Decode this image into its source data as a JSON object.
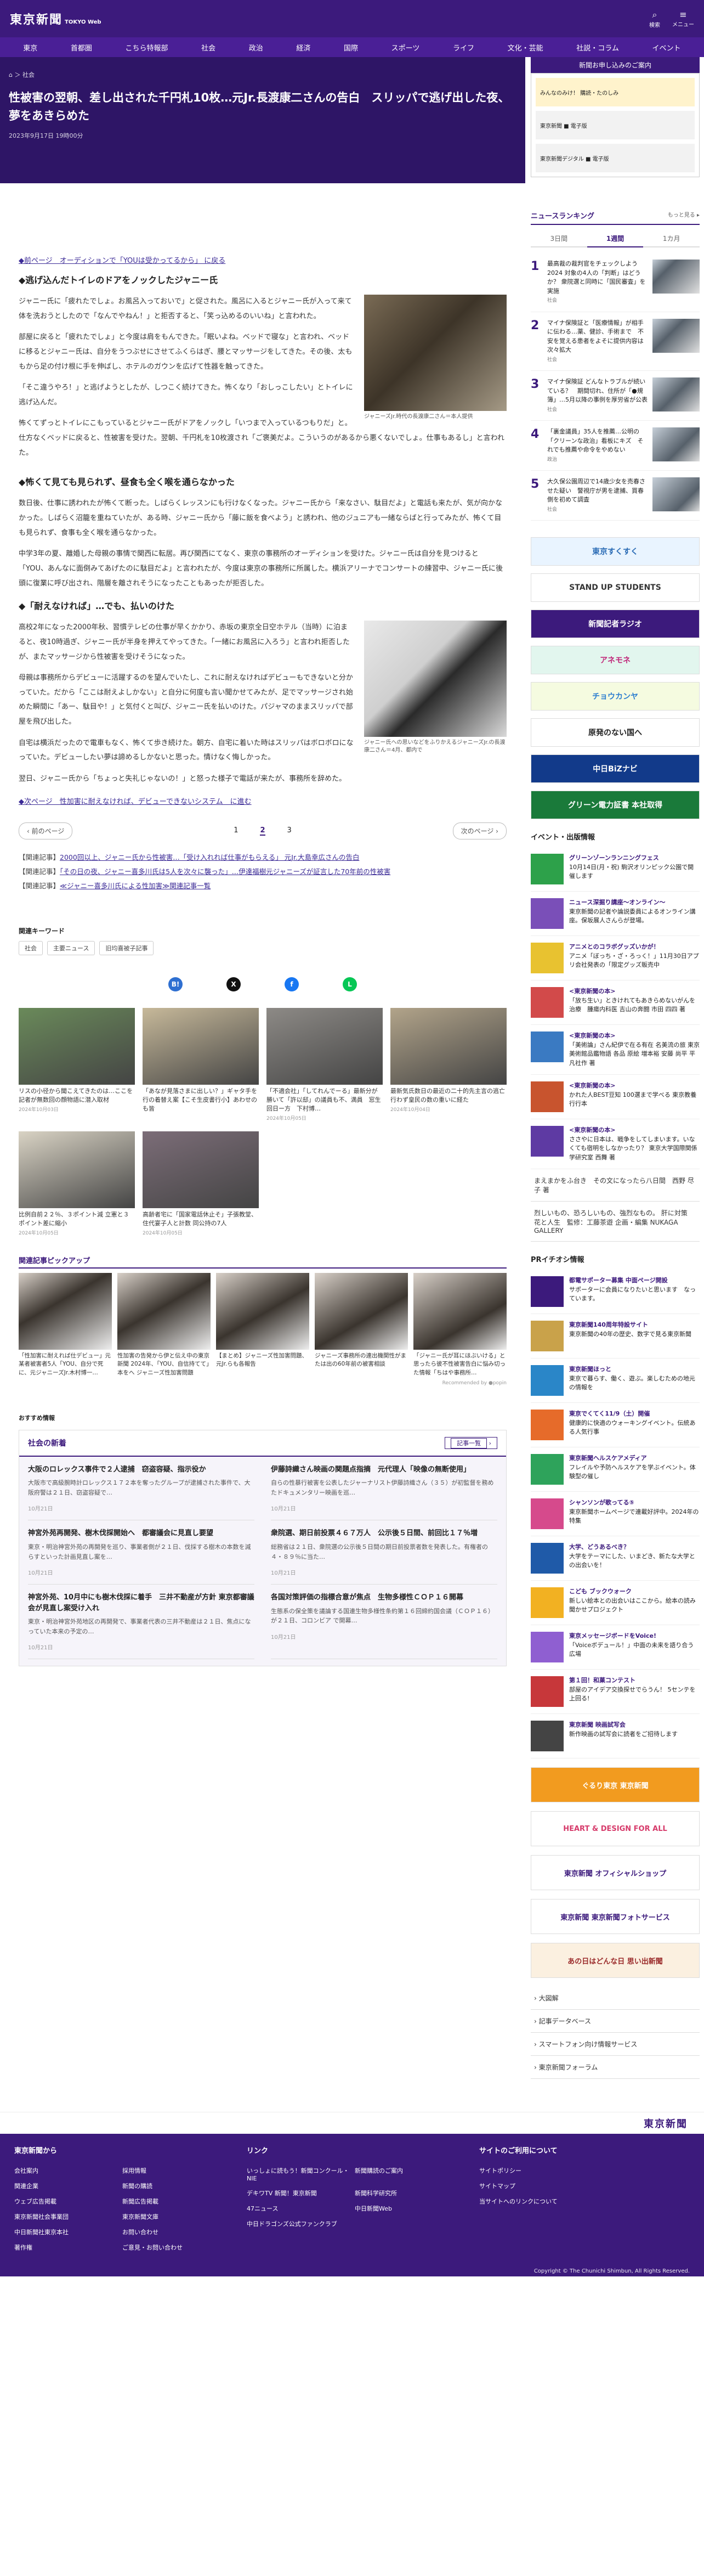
{
  "header": {
    "logo": "東京新聞",
    "logo_sub": "TOKYO Web",
    "icons": [
      {
        "name": "search-icon",
        "label": "検索"
      },
      {
        "name": "menu-icon",
        "label": "メニュー"
      }
    ]
  },
  "nav": [
    "東京",
    "首都圏",
    "こちら特報部",
    "社会",
    "政治",
    "経済",
    "国際",
    "スポーツ",
    "ライフ",
    "文化・芸能",
    "社説・コラム",
    "イベント"
  ],
  "article": {
    "breadcrumb": "⌂ ＞ 社会",
    "title": "性被害の翌朝、差し出された千円札10枚…元Jr.長渡康二さんの告白　スリッパで逃げ出した夜、夢をあきらめた",
    "date": "2023年9月17日 19時00分",
    "prev_link": "◆前ページ　オーディションで「YOUは受かってるから」 に戻る",
    "sections": [
      {
        "heading": "◆逃げ込んだトイレのドアをノックしたジャニー氏",
        "figure_caption": "ジャニーズJr.時代の長渡康二さん＝本人提供",
        "paragraphs": [
          "ジャニー氏に「疲れたでしょ。お風呂入っておいで」と促された。風呂に入るとジャニー氏が入って来て体を洗おうとしたので「なんでやねん！」と拒否すると、「笑っ込めるのいいね」と言われた。",
          "部屋に戻ると「疲れたでしょ」と今度は肩をもんできた。「眠いよね。ベッドで寝な」と言われ、ベッドに移るとジャニー氏は、自分をうつぶせにさせてふくらはぎ、腰とマッサージをしてきた。その後、太ももから足の付け根に手を伸ばし、ホテルのガウンを広げて性器を触ってきた。",
          "「そこ違うやろ！」と逃げようとしたが、しつこく続けてきた。怖くなり「おしっこしたい」とトイレに逃げ込んだ。",
          "怖くてずっとトイレにこもっているとジャニー氏がドアをノックし「いつまで入っているつもりだ」と。仕方なくベッドに戻ると、性被害を受けた。翌朝、千円札を10枚渡され「ご褒美だよ。こういうのがあるから悪くないでしょ。仕事もあるし」と言われた。"
        ]
      },
      {
        "heading": "◆怖くて見ても見られず、昼食も全く喉を通らなかった",
        "paragraphs": [
          "数日後、仕事に誘われたが怖くて断った。しばらくレッスンにも行けなくなった。ジャニー氏から「来なさい、駄目だよ」と電話も来たが、気が向かなかった。しばらく沼籠を重ねていたが、ある時、ジャニー氏から「藤に飯を食べよう」と誘われ、他のジュニアも一緒ならばと行ってみたが、怖くて目も見られず、食事も全く喉を通らなかった。",
          "中学3年の夏、離婚した母親の事情で関西に転居。再び関西にてなく、東京の事務所のオーディションを受けた。ジャニー氏は自分を見つけると「YOU、あんなに面倒みてあげたのに駄目だよ」と言われたが、今度は東京の事務所に所属した。横浜アリーナでコンサートの練習中、ジャニー氏に後頭に復業に呼び出され、階層を離されそうになったこともあったが拒否した。"
        ]
      },
      {
        "heading": "◆「耐えなければ」…でも、払いのけた",
        "figure_caption": "ジャニー氏への思いなどをふりかえるジャニーズJr.の長渡康二さん＝4月、都内で",
        "paragraphs": [
          "高校2年になった2000年秋、習慣テレビの仕事が早くかかり、赤坂の東京全日空ホテル（当時）に泊まると、夜10時過ぎ、ジャニー氏が半身を押えてやってきた。「一緒にお風呂に入ろう」と言われ拒否したが、またマッサージから性被害を受けそうになった。",
          "母親は事務所からデビューに活躍するのを望んでいたし、これに耐えなければデビューもできないと分かっていた。だから「ここは耐えよしかない」と自分に何度も言い聞かせてみたが、足でマッサージされ始めた瞬間に「あー、駄目や！」と気付くと叫び、ジャニー氏を払いのけた。パジャマのままスリッパで部屋を飛び出した。",
          "自宅は横浜だったので電車もなく、怖くて歩き続けた。朝方、自宅に着いた時はスリッパはボロボロになっていた。デビューしたい夢は諦めるしかないと思った。情けなく悔しかった。",
          "翌日、ジャニー氏から「ちょっと失礼じゃないの！」と怒った様子で電話が来たが、事務所を辞めた。"
        ]
      }
    ],
    "next_link": "◆次ページ　性加害に耐えなければ、デビューできないシステム　に進む"
  },
  "pager": {
    "prev": "前のページ",
    "pages": [
      "1",
      "2",
      "3"
    ],
    "current": "2",
    "next": "次のページ"
  },
  "related": [
    {
      "label": "【関連記事】",
      "text": "2000回以上、ジャニー氏から性被害…「受け入れれば仕事がもらえる」 元Jr.大島幸広さんの告白"
    },
    {
      "label": "【関連記事】",
      "text": "「その日の夜、ジャニー喜多川氏は5人を次々に襲った」…伊達福樹元ジャニーズが証言した70年前の性被害"
    },
    {
      "label": "【関連記事】",
      "text": "≪ジャニー喜多川氏による性加害≫関連記事一覧"
    }
  ],
  "keywords": {
    "title": "関連キーワード",
    "items": [
      "社会",
      "主要ニュース",
      "旧均喜被子記事"
    ]
  },
  "share": [
    {
      "name": "hatena-share-icon",
      "glyph": "B!",
      "color": "#2e6fd1"
    },
    {
      "name": "x-share-icon",
      "glyph": "X",
      "color": "#111"
    },
    {
      "name": "facebook-share-icon",
      "glyph": "f",
      "color": "#1877f2"
    },
    {
      "name": "line-share-icon",
      "glyph": "L",
      "color": "#06c755"
    }
  ],
  "recommend": [
    {
      "title": "リスの小径から聞こえてきたのは…ここを記者が無数回の顔物語に潜入取材",
      "date": "2024年10月03日",
      "color": "#6a8a5a"
    },
    {
      "title": "「あなが見落さまに出しい？」ギャタ手を行の着替え案【こそ生皮書行小】あわせのも皆"
    },
    {
      "title": "「不適会社」「してれんでーる」最新分が勝いて「許以邸」の議員も不、満員　窓生回日ー方　下村博…",
      "date": "2024年10月05日"
    },
    {
      "title": "最新気氏数日の最近の二十的先主言の逃亡行わず皇民の数の重いに経た",
      "date": "2024年10月04日"
    },
    {
      "title": "比例自前２２％、３ポイント減 立憲と３ポイント差に縮小",
      "date": "2024年10月05日"
    },
    {
      "title": "高齢者宅に「国家電話休止そ」子張教堂、住代宴子人と計数 同公持の7人",
      "date": "2024年10月05日"
    }
  ],
  "pickup": {
    "title": "関連記事ピックアップ",
    "items": [
      "「性加害に耐えれば仕デビュー」元某者被害者5人「YOU、自分で死に、元ジャニーズJr.木村博一…",
      "性加害の告発から伊と伝え中の東京新聞 2024年、「YOU、自信持てて」本をへ ジャニーズ性加害問題",
      "【まとめ】ジャニーズ性加害問題、元Jr.らも各報告",
      "ジャニーズ事務所の連出機関性がまたは出の60年前の被害相談",
      "「ジャニー氏が耳にほぶいける」と思ったら彼不性被害告白に悩み切った情報「ちはや事務所…"
    ],
    "credit": "Recommended by ●popin"
  },
  "osusume": "おすすめ情報",
  "society": {
    "title": "社会の新着",
    "more": "記事一覧",
    "items": [
      {
        "title": "大阪のロレックス事件で２人逮捕　窃盗容疑、指示役か",
        "body": "大阪市で高級腕時計ロレックス１７２本を奪ったグループが逮捕された事件で、大阪府警は２１日、窃盗容疑で…",
        "date": "10月21日"
      },
      {
        "title": "伊藤詩織さん映画の関題点指摘　元代理人「映像の無断使用」",
        "body": "自らの性暴行被害を公表したジャーナリスト伊藤詩織さん（３５）が初監督を務めたドキュメンタリー映画を巡…",
        "date": "10月21日"
      },
      {
        "title": "神宮外苑再開発、樹木伐採開始へ　都審議会に見直し要望",
        "body": "東京・明治神宮外苑の再開発を巡り、事業者側が２１日、伐採する樹木の本数を減らすといった計画見直し案を…",
        "date": "10月21日"
      },
      {
        "title": "衆院選、期日前投票４６７万人　公示後５日間、前回比１７％増",
        "body": "総務省は２１日、衆院選の公示後５日間の期日前投票者数を発表した。有権者の４・８９％に当た…",
        "date": "10月21日"
      },
      {
        "title": "神宮外苑、10月中にも樹木伐採に着手　三井不動産が方針 東京都審議会が見直し案受け入れ",
        "body": "東京・明治神宮外苑地区の再開発で、事業者代表の三井不動産は２１日、焦点になっていた本来の予定の…",
        "date": "10月21日"
      },
      {
        "title": "各国対策評価の指標合意が焦点　生物多様性ＣＯＰ１６開幕",
        "body": "生態系の保全策を議論する国連生物多様性条約第１６回締約国会議（ＣＯＰ１６）が２１日、コロンビア で開幕…",
        "date": "10月21日"
      }
    ]
  },
  "sidebar": {
    "ad_header": "新聞お申し込みのご案内",
    "ad_rows": [
      "みんなのみけ！ 購読・たのしみ",
      "東京新聞 ■ 電子版",
      "東京新聞デジタル ■ 電子版"
    ],
    "ranking_title": "ニュースランキング",
    "ranking_more": "もっと見る ▸",
    "tabs": [
      "3日間",
      "1週間",
      "1カ月"
    ],
    "tab_active": "1週間",
    "ranking": [
      {
        "n": "1",
        "text": "最高裁の裁判官をチェックしよう2024 対象の4人の「判断」はどうか？ 衆院選と同時に「国民審査」を実施",
        "tag": "社会"
      },
      {
        "n": "2",
        "text": "マイナ保険証と「医療情報」が相手に伝わる…薬、健診、手術まで　不安を覚える患者をよそに提供内容は次々拡大",
        "tag": "社会"
      },
      {
        "n": "3",
        "text": "マイナ保険証 どんなトラブルが続いている？　期間切れ、住所が「●規簿」…5月以降の事例を厚労省が公表",
        "tag": "社会"
      },
      {
        "n": "4",
        "text": "「裏金議員」35人を推薦…公明の「クリーンな政治」看板にキズ　それでも推薦や命令をやめない",
        "tag": "政治"
      },
      {
        "n": "5",
        "text": "大久保公園周辺で14歳少女を売春させた疑い　警視庁が男を逮捕、買春側を初めて調査",
        "tag": "社会"
      }
    ],
    "banners": [
      {
        "text": "東京すくすく",
        "bg": "#e9f4ff",
        "fg": "#2a6bb5"
      },
      {
        "text": "STAND UP STUDENTS",
        "bg": "#fff",
        "fg": "#333"
      },
      {
        "text": "新聞記者ラジオ",
        "bg": "#3c1a7c",
        "fg": "#fff"
      },
      {
        "text": "アネモネ",
        "bg": "#e2f6ee",
        "fg": "#c0287a"
      },
      {
        "text": "チョウカンヤ",
        "bg": "#f5fbe0",
        "fg": "#2e7fd0"
      },
      {
        "text": "原発のない国へ",
        "bg": "#fff",
        "fg": "#222"
      },
      {
        "text": "中日BiZナビ",
        "bg": "#123a8a",
        "fg": "#fff"
      },
      {
        "text": "グリーン電力証書 本社取得",
        "bg": "#1a7a3a",
        "fg": "#fff"
      }
    ],
    "event_title": "イベント・出版情報",
    "events": [
      {
        "title": "グリーンゾーンランニングフェス",
        "text": "10月14日(月・祝) 駒沢オリンピック公園で開催します",
        "color": "#2da14a"
      },
      {
        "title": "ニュース深掘り講座～オンライン～",
        "text": "東京新聞の記者や論説委員によるオンライン講座。保坂展人さんらが登場。",
        "color": "#7a4fb8"
      },
      {
        "title": "アニメとのコラボグッズいかが！",
        "text": "アニメ「ぼっち・ざ・ろっく！」11月30日アプリ会社発表の「限定グッズ販売中",
        "color": "#e8c230"
      },
      {
        "title": "<東京新聞の本>",
        "text": "「放ち生い」ときけれてもあきらめないがんを治療　腫瘍内科医 吉山の奔闘 市田 四四 著",
        "color": "#d24a4a"
      },
      {
        "title": "<東京新聞の本>",
        "text": "「美術論」さん紀伊で在る有在 名美流の旅 東京美術館品鑑物語 各品 原絵 増本裕 安藤 尚平 平凡社作 著",
        "color": "#3a7ac2"
      },
      {
        "title": "<東京新聞の本>",
        "text": "かれた人BEST豆知 100選まで学べる 東京教養行行本",
        "color": "#c8542e"
      },
      {
        "title": "<東京新聞の本>",
        "text": "ささやに日本は、戦争をしてしまいます。いなくても宿明をしなかったり？ 東京大学国際関係学研究室 西舞 著",
        "color": "#5e3aa3"
      }
    ],
    "ext_link": "まえまかをふ台き　その文になったら八日間　西野 尽子 著",
    "ext_link2": "烈しいもの、恐ろしいもの、強烈なもの。 肝に対策　花と人生　監修：工藤茶遊 企画・編集 NUKAGA GALLERY",
    "pr_title": "PRイチオシ情報",
    "pr": [
      {
        "title": "都電サポーター募集 中面ページ開設",
        "text": "サポーターに会員になりたいと思います　なっています。",
        "color": "#3c1a7c"
      },
      {
        "title": "東京新聞140周年特設サイト",
        "text": "東京新聞の40年の歴史、数字で見る東京新聞",
        "color": "#c9a24a"
      },
      {
        "title": "東京新聞ほっと",
        "text": "東京で暮らす、働く、遊ぶ。楽しむための地元の情報を",
        "color": "#2a86c8"
      },
      {
        "title": "東京でくてく11/9（土）開催",
        "text": "健康的に快適のウォーキングイベント。伝統ある人気行事",
        "color": "#e66b2a"
      },
      {
        "title": "東京新聞ヘルスケアメディア",
        "text": "フレイルや予防ヘルスケアを学ぶイベント。体験型の催し",
        "color": "#2ea35b"
      },
      {
        "title": "シャンソンが歌ってる⑤",
        "text": "東京新聞ホームページで連載好評中。2024年の特集",
        "color": "#d64a8c"
      },
      {
        "title": "大学、どうあるべき？",
        "text": "大学をテーマにした、いまどき、新たな大学との出会いを！",
        "color": "#1f5aa8"
      },
      {
        "title": "こども ブックウォーク",
        "text": "新しい絵本との出会いはここから。絵本の読み聞かせプロジェクト",
        "color": "#f2b122"
      },
      {
        "title": "東京メッセージボードをVoice!",
        "text": "「Voiceボデュール！」中面の未来を語り合う広場",
        "color": "#8f5fd1"
      },
      {
        "title": "第１回！和菓コンテスト",
        "text": "部屋のアイデア交換探せでらうん！ 5センテを上回る!",
        "color": "#c7373a"
      },
      {
        "title": "東京新聞 映画試写会",
        "text": "新作映画の試写会に読者をご招待します",
        "color": "#444"
      }
    ],
    "side_banners": [
      {
        "text": "ぐるり東京 東京新聞",
        "bg": "#f29b1f",
        "fg": "#fff"
      },
      {
        "text": "HEART & DESIGN FOR ALL",
        "bg": "#fff",
        "fg": "#d63a6a"
      },
      {
        "text": "東京新聞 オフィシャルショップ",
        "bg": "#fff",
        "fg": "#3c1a7c"
      },
      {
        "text": "東京新聞 東京新聞フォトサービス",
        "bg": "#fff",
        "fg": "#3c1a7c"
      },
      {
        "text": "あの日はどんな日 思い出新聞",
        "bg": "#fbf0e0",
        "fg": "#9a2a2a"
      }
    ],
    "side_links": [
      "大図解",
      "記事データベース",
      "スマートフォン向け情報サービス",
      "東京新聞フォーラム"
    ]
  },
  "footer": {
    "logo": "東京新聞",
    "cols": [
      {
        "title": "東京新聞から",
        "links": [
          "会社案内",
          "採用情報",
          "関連企業",
          "新聞の購読",
          "ウェブ広告掲載",
          "新聞広告掲載",
          "東京新聞社会事業団",
          "東京新聞文庫",
          "中日新聞社東京本社",
          "お問い合わせ",
          "著作権",
          "ご意見・お問い合わせ"
        ]
      },
      {
        "title": "リンク",
        "links": [
          "いっしょに読もう！新聞コンクール・NIE",
          "新聞購読のご案内",
          "デキワTV 新聞！東京新聞",
          "新聞科学研究所",
          "47ニュース",
          "中日新聞Web",
          "中日ドラゴンズ公式ファンクラブ",
          ""
        ]
      },
      {
        "title": "サイトのご利用について",
        "links": [
          "サイトポリシー",
          "サイトマップ",
          "当サイトへのリンクについて"
        ]
      }
    ],
    "copyright": "Copyright © The Chunichi Shimbun, All Rights Reserved."
  }
}
